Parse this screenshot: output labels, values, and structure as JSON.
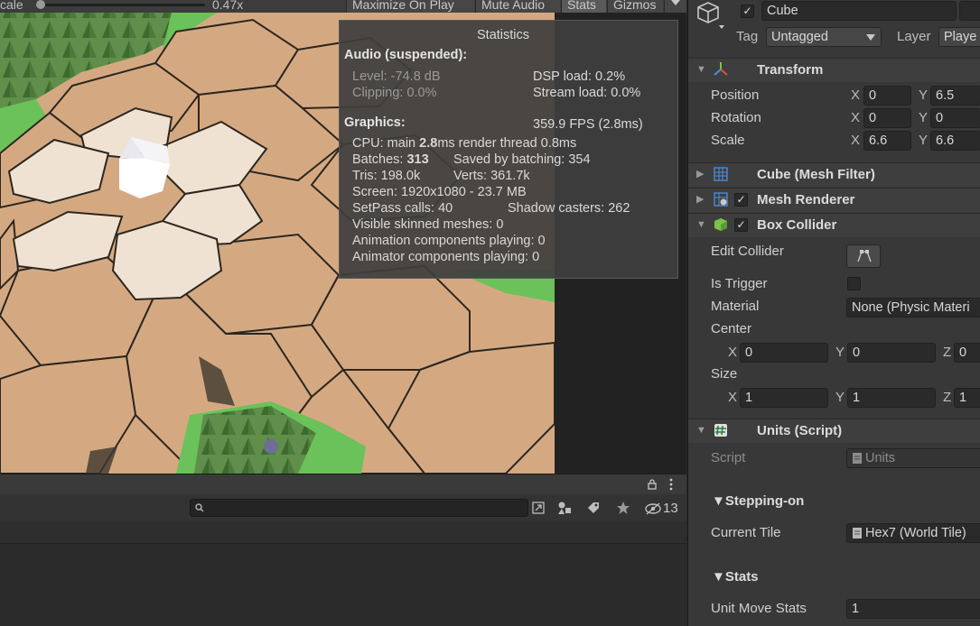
{
  "game_toolbar": {
    "scale_label": "cale",
    "scale_value": "0.47x",
    "maximize_label": "Maximize On Play",
    "mute_label": "Mute Audio",
    "stats_label": "Stats",
    "gizmos_label": "Gizmos"
  },
  "statistics": {
    "title": "Statistics",
    "audio_header": "Audio (suspended):",
    "level": "Level: -74.8 dB",
    "clipping": "Clipping: 0.0%",
    "dsp_load": "DSP load: 0.2%",
    "stream_load": "Stream load: 0.0%",
    "graphics_header": "Graphics:",
    "fps": "359.9 FPS (2.8ms)",
    "cpu_prefix": "CPU: main ",
    "cpu_main": "2.8",
    "cpu_suffix": "ms  render thread 0.8ms",
    "batches_prefix": "Batches: ",
    "batches": "313",
    "saved_by_batching": "Saved by batching: 354",
    "tris": "Tris: 198.0k",
    "verts": "Verts: 361.7k",
    "screen": "Screen: 1920x1080 - 23.7 MB",
    "setpass": "SetPass calls: 40",
    "shadow_casters": "Shadow casters: 262",
    "skinned": "Visible skinned meshes: 0",
    "animation": "Animation components playing: 0",
    "animator": "Animator components playing: 0"
  },
  "bottom_panel": {
    "search_value": "",
    "hidden_count": "13"
  },
  "inspector": {
    "object_name": "Cube",
    "tag_label": "Tag",
    "tag_value": "Untagged",
    "layer_label": "Layer",
    "layer_value": "Playe",
    "transform": {
      "title": "Transform",
      "position_label": "Position",
      "rotation_label": "Rotation",
      "scale_label": "Scale",
      "x_label": "X",
      "y_label": "Y",
      "position_x": "0",
      "position_y": "6.5",
      "rotation_x": "0",
      "rotation_y": "0",
      "scale_x": "6.6",
      "scale_y": "6.6"
    },
    "mesh_filter_title": "Cube (Mesh Filter)",
    "mesh_renderer_title": "Mesh Renderer",
    "box_collider": {
      "title": "Box Collider",
      "edit_collider_label": "Edit Collider",
      "is_trigger_label": "Is Trigger",
      "material_label": "Material",
      "material_value": "None (Physic Materi",
      "center_label": "Center",
      "size_label": "Size",
      "x_label": "X",
      "y_label": "Y",
      "z_label": "Z",
      "center_x": "0",
      "center_y": "0",
      "center_z": "0",
      "size_x": "1",
      "size_y": "1",
      "size_z": "1"
    },
    "units_script": {
      "title": "Units (Script)",
      "script_label": "Script",
      "script_value": "Units",
      "stepping_header": "▼Stepping-on",
      "current_tile_label": "Current Tile",
      "current_tile_value": "Hex7 (World Tile)",
      "stats_header": "▼Stats",
      "unit_move_stats_label": "Unit Move Stats",
      "unit_move_stats_value": "1"
    }
  }
}
